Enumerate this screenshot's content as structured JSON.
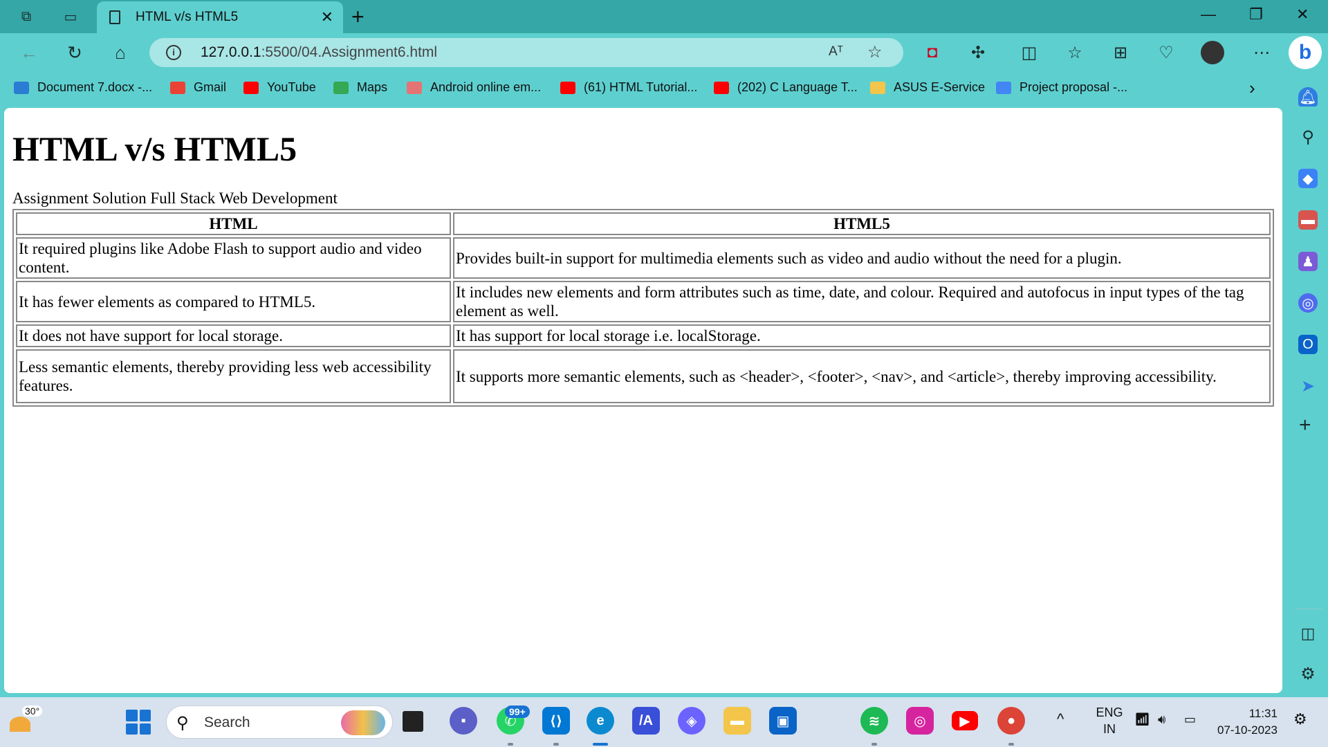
{
  "browser": {
    "tab": {
      "title": "HTML v/s HTML5"
    },
    "address": {
      "host": "127.0.0.1",
      "path": ":5500/04.Assignment6.html"
    },
    "read_aloud_label": "Aᵀ",
    "favorites": [
      {
        "label": "Document 7.docx -...",
        "icon": "word-icon",
        "color": "#2b7cd3"
      },
      {
        "label": "Gmail",
        "icon": "gmail-icon",
        "color": "#ea4335"
      },
      {
        "label": "YouTube",
        "icon": "youtube-icon",
        "color": "#ff0000"
      },
      {
        "label": "Maps",
        "icon": "maps-icon",
        "color": "#34a853"
      },
      {
        "label": "Android online em...",
        "icon": "android-emulator-icon",
        "color": "#e57373"
      },
      {
        "label": "(61) HTML Tutorial...",
        "icon": "youtube-icon",
        "color": "#ff0000"
      },
      {
        "label": "(202) C Language T...",
        "icon": "youtube-icon",
        "color": "#ff0000"
      },
      {
        "label": "ASUS E-Service",
        "icon": "folder-icon",
        "color": "#f3c54a"
      },
      {
        "label": "Project proposal -...",
        "icon": "docs-icon",
        "color": "#4285f4"
      }
    ]
  },
  "page": {
    "heading": "HTML v/s HTML5",
    "subtitle": "Assignment Solution Full Stack Web Development",
    "table": {
      "headers": [
        "HTML",
        "HTML5"
      ],
      "rows": [
        [
          "It required plugins like Adobe Flash to support audio and video content.",
          "Provides built-in support for multimedia elements such as video and audio without the need for a plugin."
        ],
        [
          "It has fewer elements as compared to HTML5.",
          "It includes new elements and form attributes such as time, date, and colour. Required and autofocus in input types of the tag element as well."
        ],
        [
          "It does not have support for local storage.",
          "It has support for local storage i.e. localStorage."
        ],
        [
          "Less semantic elements, thereby providing less web accessibility features.",
          "It supports more semantic elements, such as <header>, <footer>, <nav>, and <article>, thereby improving accessibility."
        ]
      ]
    }
  },
  "taskbar": {
    "weather_temp": "30°",
    "search_label": "Search",
    "whatsapp_badge": "99+",
    "language": "ENG",
    "region": "IN",
    "time": "11:31",
    "date": "07-10-2023"
  }
}
